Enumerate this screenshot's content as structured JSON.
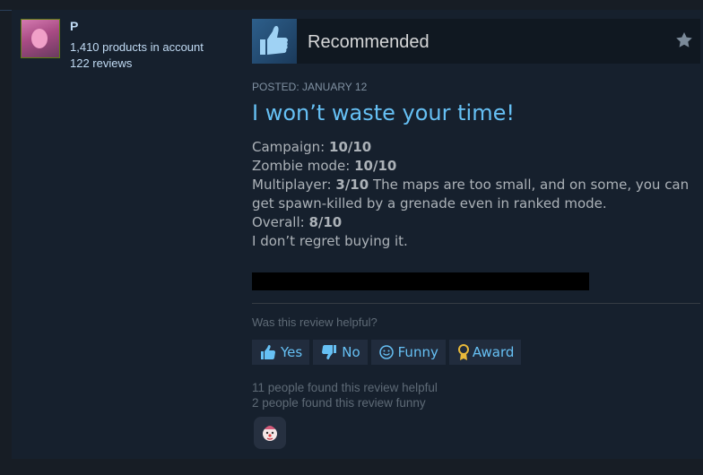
{
  "author": {
    "name": "P",
    "products": "1,410 products in account",
    "reviews": "122 reviews"
  },
  "review": {
    "verdict": "Recommended",
    "posted": "POSTED: JANUARY 12",
    "title": "I won’t waste your time!",
    "lines": {
      "campaign_label": "Campaign: ",
      "campaign_score": "10/10",
      "zombie_label": "Zombie mode: ",
      "zombie_score": "10/10",
      "multi_label": "Multiplayer: ",
      "multi_score": "3/10",
      "multi_note": " The maps are too small, and on some, you can get spawn-killed by a grenade even in ranked mode.",
      "overall_label": "Overall: ",
      "overall_score": "8/10",
      "closing": "I don’t regret buying it."
    }
  },
  "feedback": {
    "question": "Was this review helpful?",
    "yes": "Yes",
    "no": "No",
    "funny": "Funny",
    "award": "Award",
    "helpful_count": "11 people found this review helpful",
    "funny_count": "2 people found this review funny"
  },
  "colors": {
    "accent": "#66c0f4",
    "background": "#16202d"
  }
}
